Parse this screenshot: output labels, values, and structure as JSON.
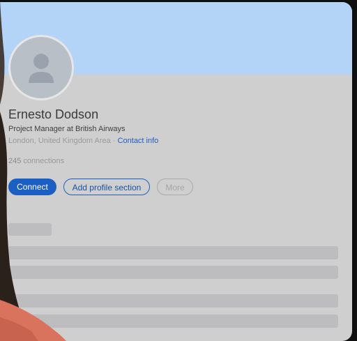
{
  "profile": {
    "name": "Ernesto Dodson",
    "headline": "Project Manager at British Airways",
    "location": "London, United Kingdom Area",
    "separator": "·",
    "contact_link": "Contact info",
    "connections_count": "245",
    "connections_label": "connections"
  },
  "actions": {
    "connect_label": "Connect",
    "add_section_label": "Add profile section",
    "more_label": "More"
  },
  "colors": {
    "banner": "#b3d3f7",
    "primary": "#1b5fc2",
    "card": "#cfcfcf"
  },
  "icons": {
    "avatar": "default-person-icon"
  }
}
